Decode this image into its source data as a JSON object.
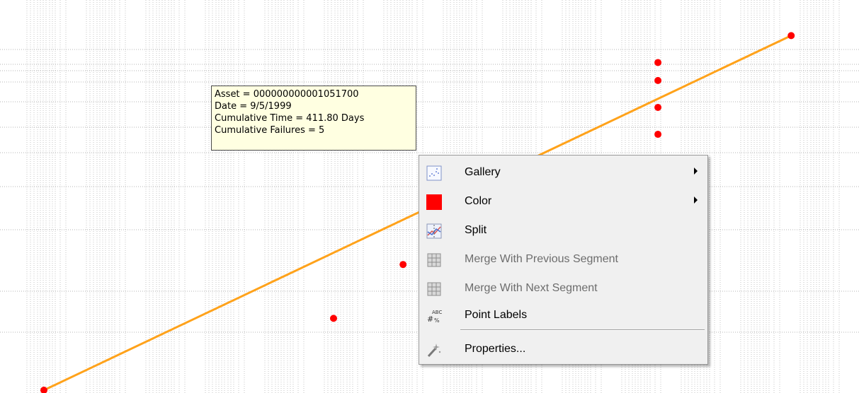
{
  "chart_data": {
    "type": "scatter",
    "title": "",
    "xlabel": "",
    "ylabel": "",
    "points": [
      {
        "x": 0.0,
        "y": 0.0
      },
      {
        "x": 0.5,
        "y": 0.8
      },
      {
        "x": 0.62,
        "y": 1.4
      },
      {
        "x": 0.66,
        "y": 1.7
      },
      {
        "x": 0.7,
        "y": 2.0
      },
      {
        "x": 0.86,
        "y": 2.3
      },
      {
        "x": 1.06,
        "y": 2.85
      },
      {
        "x": 1.06,
        "y": 3.15
      },
      {
        "x": 1.06,
        "y": 3.45
      },
      {
        "x": 1.06,
        "y": 3.65
      },
      {
        "x": 1.29,
        "y": 3.95
      }
    ],
    "fit_line": {
      "x": [
        0.0,
        1.29
      ],
      "y": [
        0.0,
        3.95
      ]
    },
    "grid": true,
    "point_color": "#ff0000",
    "line_color": "#ffa21a"
  },
  "tooltip": {
    "asset": "Asset = 000000000001051700",
    "date": "Date = 9/5/1999",
    "cumulative_time": "Cumulative Time = 411.80 Days",
    "cumulative_failures": "Cumulative Failures = 5"
  },
  "context_menu": {
    "items": [
      {
        "label": "Gallery",
        "icon": "gallery-icon",
        "submenu": true,
        "enabled": true
      },
      {
        "label": "Color",
        "icon": "color-swatch-icon",
        "submenu": true,
        "enabled": true,
        "swatch": "#ff0000"
      },
      {
        "label": "Split",
        "icon": "split-icon",
        "submenu": false,
        "enabled": true
      },
      {
        "label": "Merge With Previous Segment",
        "icon": "merge-previous-icon",
        "submenu": false,
        "enabled": false
      },
      {
        "label": "Merge With Next Segment",
        "icon": "merge-next-icon",
        "submenu": false,
        "enabled": false
      },
      {
        "label": "Point Labels",
        "icon": "point-labels-icon",
        "submenu": false,
        "enabled": true
      },
      {
        "label": "Properties...",
        "icon": "properties-icon",
        "submenu": false,
        "enabled": true
      }
    ]
  }
}
